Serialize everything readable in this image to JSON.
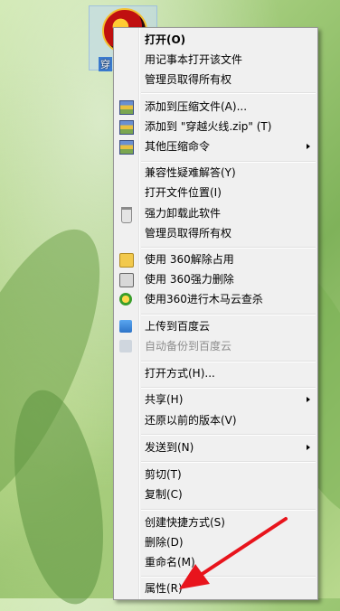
{
  "desktop_icon": {
    "label": "穿"
  },
  "menu": {
    "items": [
      {
        "label": "打开(O)",
        "bold": true
      },
      {
        "label": "用记事本打开该文件"
      },
      {
        "label": "管理员取得所有权"
      },
      {
        "label": "添加到压缩文件(A)...",
        "icon": "archive-icon"
      },
      {
        "label": "添加到 \"穿越火线.zip\" (T)",
        "icon": "archive-icon"
      },
      {
        "label": "其他压缩命令",
        "icon": "archive-icon",
        "submenu": true
      },
      {
        "label": "兼容性疑难解答(Y)"
      },
      {
        "label": "打开文件位置(I)"
      },
      {
        "label": "强力卸载此软件",
        "icon": "trash-icon"
      },
      {
        "label": "管理员取得所有权"
      },
      {
        "label": "使用 360解除占用",
        "icon": "unlock-icon"
      },
      {
        "label": "使用 360强力删除",
        "icon": "shredder-icon"
      },
      {
        "label": "使用360进行木马云查杀",
        "icon": "360-icon"
      },
      {
        "label": "上传到百度云",
        "icon": "cloud-icon"
      },
      {
        "label": "自动备份到百度云",
        "icon": "cloud-backup-icon",
        "disabled": true
      },
      {
        "label": "打开方式(H)..."
      },
      {
        "label": "共享(H)",
        "submenu": true
      },
      {
        "label": "还原以前的版本(V)"
      },
      {
        "label": "发送到(N)",
        "submenu": true
      },
      {
        "label": "剪切(T)"
      },
      {
        "label": "复制(C)"
      },
      {
        "label": "创建快捷方式(S)"
      },
      {
        "label": "删除(D)"
      },
      {
        "label": "重命名(M)"
      },
      {
        "label": "属性(R)"
      }
    ]
  },
  "colors": {
    "annotation_arrow": "#e8141c",
    "menu_bg": "#f0f0f0"
  }
}
